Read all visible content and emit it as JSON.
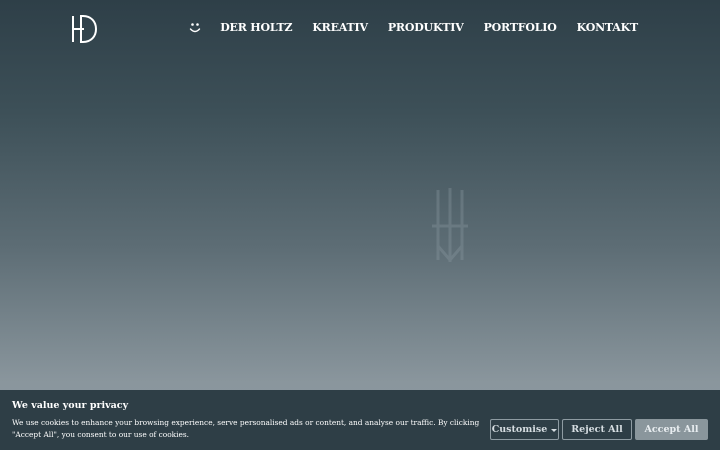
{
  "header": {
    "logo_icon": "hd-monogram-logo",
    "smile_icon": "smiley-face-icon",
    "nav": [
      {
        "label": "DER HOLTZ"
      },
      {
        "label": "KREATIV"
      },
      {
        "label": "PRODUKTIV"
      },
      {
        "label": "PORTFOLIO"
      },
      {
        "label": "KONTAKT"
      }
    ]
  },
  "hero": {
    "mark_icon": "faint-logo-watermark"
  },
  "cookie_banner": {
    "title": "We value your privacy",
    "text": "We use cookies to enhance your browsing experience, serve personalised ads or content, and analyse our traffic. By clicking \"Accept All\", you consent to our use of cookies.",
    "customise_label": "Customise",
    "reject_label": "Reject All",
    "accept_label": "Accept All",
    "background_color": "#2e3e46",
    "accept_color": "#8a969c"
  }
}
